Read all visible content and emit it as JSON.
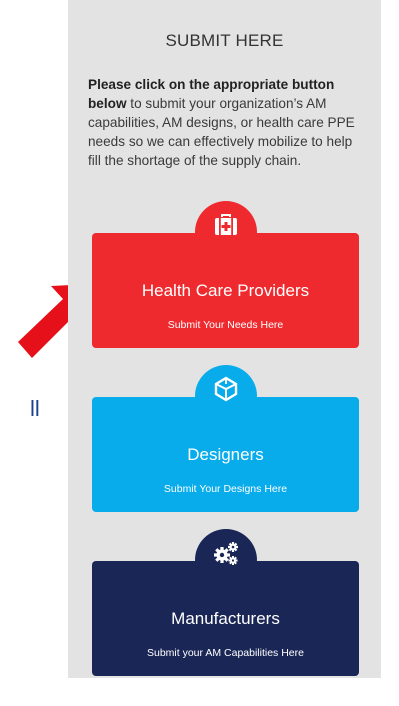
{
  "edge_text": "ll",
  "panel": {
    "title": "SUBMIT HERE",
    "intro_bold": "Please click on the appropriate button below",
    "intro_rest": " to submit your organization’s AM capabilities, AM designs, or  health care PPE needs so we can effectively mobilize to help fill the shortage of the supply chain."
  },
  "cards": [
    {
      "title": "Health Care Providers",
      "subtitle": "Submit Your Needs Here",
      "icon": "medical-kit-icon",
      "color": "#ef2a2f"
    },
    {
      "title": "Designers",
      "subtitle": "Submit Your Designs Here",
      "icon": "cube-design-icon",
      "color": "#08aceb"
    },
    {
      "title": "Manufacturers",
      "subtitle": "Submit your AM Capabilities Here",
      "icon": "gears-icon",
      "color": "#1a2756"
    }
  ],
  "colors": {
    "arrow": "#e5101a",
    "panel_bg": "#e3e3e4",
    "edge_text": "#1f3f95"
  }
}
